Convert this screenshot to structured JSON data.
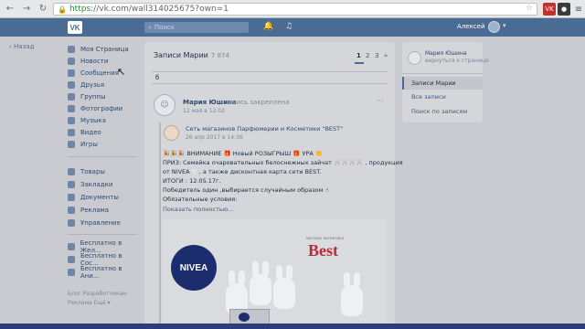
{
  "browser": {
    "url_secure": "https",
    "url_rest": "://vk.com/wall314025675?own=1",
    "ext1": "VK",
    "ext1_color": "#c4302b"
  },
  "header": {
    "logo": "VK",
    "search_placeholder": "Поиск",
    "user_name": "Алексей"
  },
  "sidebar": {
    "back_label": "Назад",
    "items": [
      {
        "label": "Моя Страница"
      },
      {
        "label": "Новости"
      },
      {
        "label": "Сообщения"
      },
      {
        "label": "Друзья"
      },
      {
        "label": "Группы"
      },
      {
        "label": "Фотографии"
      },
      {
        "label": "Музыка"
      },
      {
        "label": "Видео"
      },
      {
        "label": "Игры"
      }
    ],
    "items2": [
      {
        "label": "Товары"
      },
      {
        "label": "Закладки"
      },
      {
        "label": "Документы"
      },
      {
        "label": "Реклама"
      },
      {
        "label": "Управление"
      }
    ],
    "items3": [
      {
        "label": "Бесплатно в Жел..."
      },
      {
        "label": "Бесплатно в Сос..."
      },
      {
        "label": "Бесплатно в Ани..."
      }
    ],
    "footer1": "Блог   Разработчикам",
    "footer2": "Реклама   Ещё ▾"
  },
  "wall": {
    "title": "Записи Марии",
    "count": "7 874",
    "pages": [
      "1",
      "2",
      "3",
      "»"
    ],
    "current_page": "1",
    "search_value": "б",
    "post": {
      "author": "Мария Юшина",
      "meta": "запись закреплена",
      "date": "12 мая в 12:02",
      "more": "···",
      "repost": {
        "source": "Сеть магазинов Парфюмерии и Косметики \"BEST\"",
        "date": "26 апр 2017 в 14:36",
        "lines": [
          "🎉🎉🎉 ВНИМАНИЕ 🎁 Новый РОЗЫГРЫШ 🎁 УРА 👏",
          "ПРИЗ: Семейка очаровательных белоснежных зайчат 🐰🐰🐰🐰 , продукция",
          "от NIVEA 🤍, а также дисконтная карта сети BEST.",
          "ИТОГИ : 12.05.17г.",
          "Победитель один ,выбирается случайным образом ☝",
          "Обязательные условия:"
        ],
        "show_more": "Показать полностью..."
      },
      "image": {
        "brand1": "NIVEA",
        "brand2": "Best",
        "brand2_small": "магазин косметики"
      }
    }
  },
  "right": {
    "name": "Мария Юшина",
    "return_link": "вернуться к странице",
    "items": [
      {
        "label": "Записи Марии",
        "active": true
      },
      {
        "label": "Все записи",
        "active": false
      },
      {
        "label": "Поиск по записям",
        "active": false
      }
    ]
  }
}
